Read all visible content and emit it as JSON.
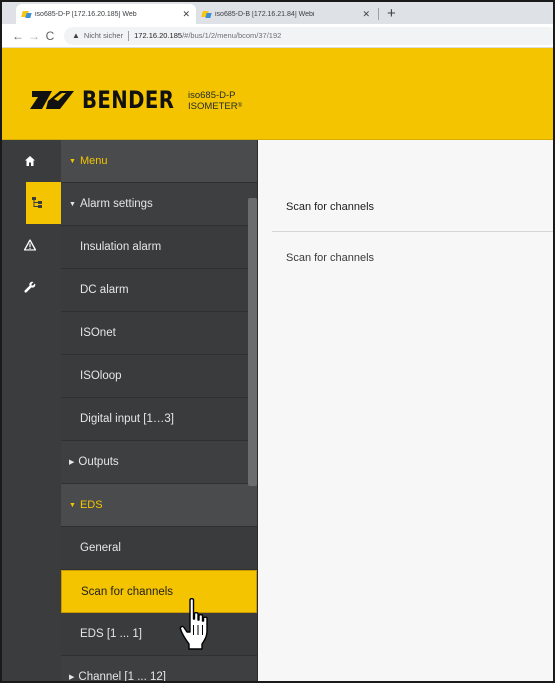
{
  "browser": {
    "tabs": [
      {
        "title": "iso685-D-P [172.16.20.185] Web",
        "active": true
      },
      {
        "title": "iso685-D-B [172.16.21.84] Webi",
        "active": false
      }
    ],
    "new_tab": "+",
    "address": {
      "security_label": "Nicht sicher",
      "url_host": "172.16.20.185",
      "url_path": "/#/bus/1/2/menu/bcom/37/192"
    }
  },
  "header": {
    "brand": "BENDER",
    "device_line1": "iso685-D-P",
    "device_line2": "ISOMETER",
    "device_reg": "®"
  },
  "rail": {
    "items": [
      {
        "icon": "home-icon"
      },
      {
        "icon": "menu-tree-icon"
      },
      {
        "icon": "alarm-warning-icon"
      },
      {
        "icon": "wrench-icon"
      }
    ]
  },
  "menu": {
    "items": [
      {
        "label": "Menu",
        "caret": "▼"
      },
      {
        "label": "Alarm settings",
        "caret": "▼"
      },
      {
        "label": "Insulation alarm"
      },
      {
        "label": "DC alarm"
      },
      {
        "label": "ISOnet"
      },
      {
        "label": "ISOloop"
      },
      {
        "label": "Digital input [1…3]"
      },
      {
        "label": "Outputs",
        "caret": "▶"
      },
      {
        "label": "EDS",
        "caret": "▼"
      },
      {
        "label": "General"
      },
      {
        "label": "Scan for channels"
      },
      {
        "label": "EDS [1 ... 1]"
      },
      {
        "label": "Channel [1 ... 12]",
        "caret": "▶"
      }
    ]
  },
  "content": {
    "title": "Scan for channels",
    "label": "Scan for channels"
  },
  "colors": {
    "accent": "#f5c400",
    "menu_bg": "#3a3b3d",
    "content_bg": "#f7f7f7"
  }
}
